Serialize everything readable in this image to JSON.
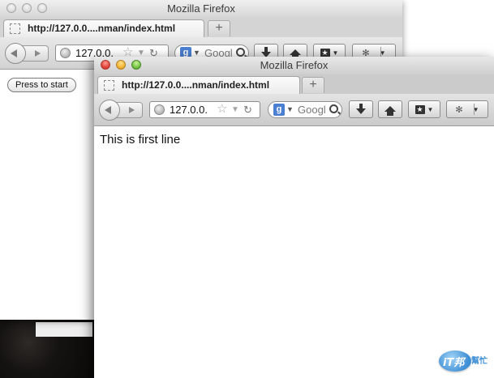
{
  "back_window": {
    "title": "Mozilla Firefox",
    "tab_title": "http://127.0.0....nman/index.html",
    "new_tab_label": "+",
    "url": "127.0.0.",
    "search_placeholder": "Googl",
    "search_engine_letter": "g",
    "start_button_label": "Press to start"
  },
  "front_window": {
    "title": "Mozilla Firefox",
    "tab_title": "http://127.0.0....nman/index.html",
    "new_tab_label": "+",
    "url": "127.0.0.",
    "search_placeholder": "Googl",
    "search_engine_letter": "g",
    "content_text": "This is first line"
  },
  "watermark": {
    "brand": "iT邦",
    "text": "幫忙"
  }
}
